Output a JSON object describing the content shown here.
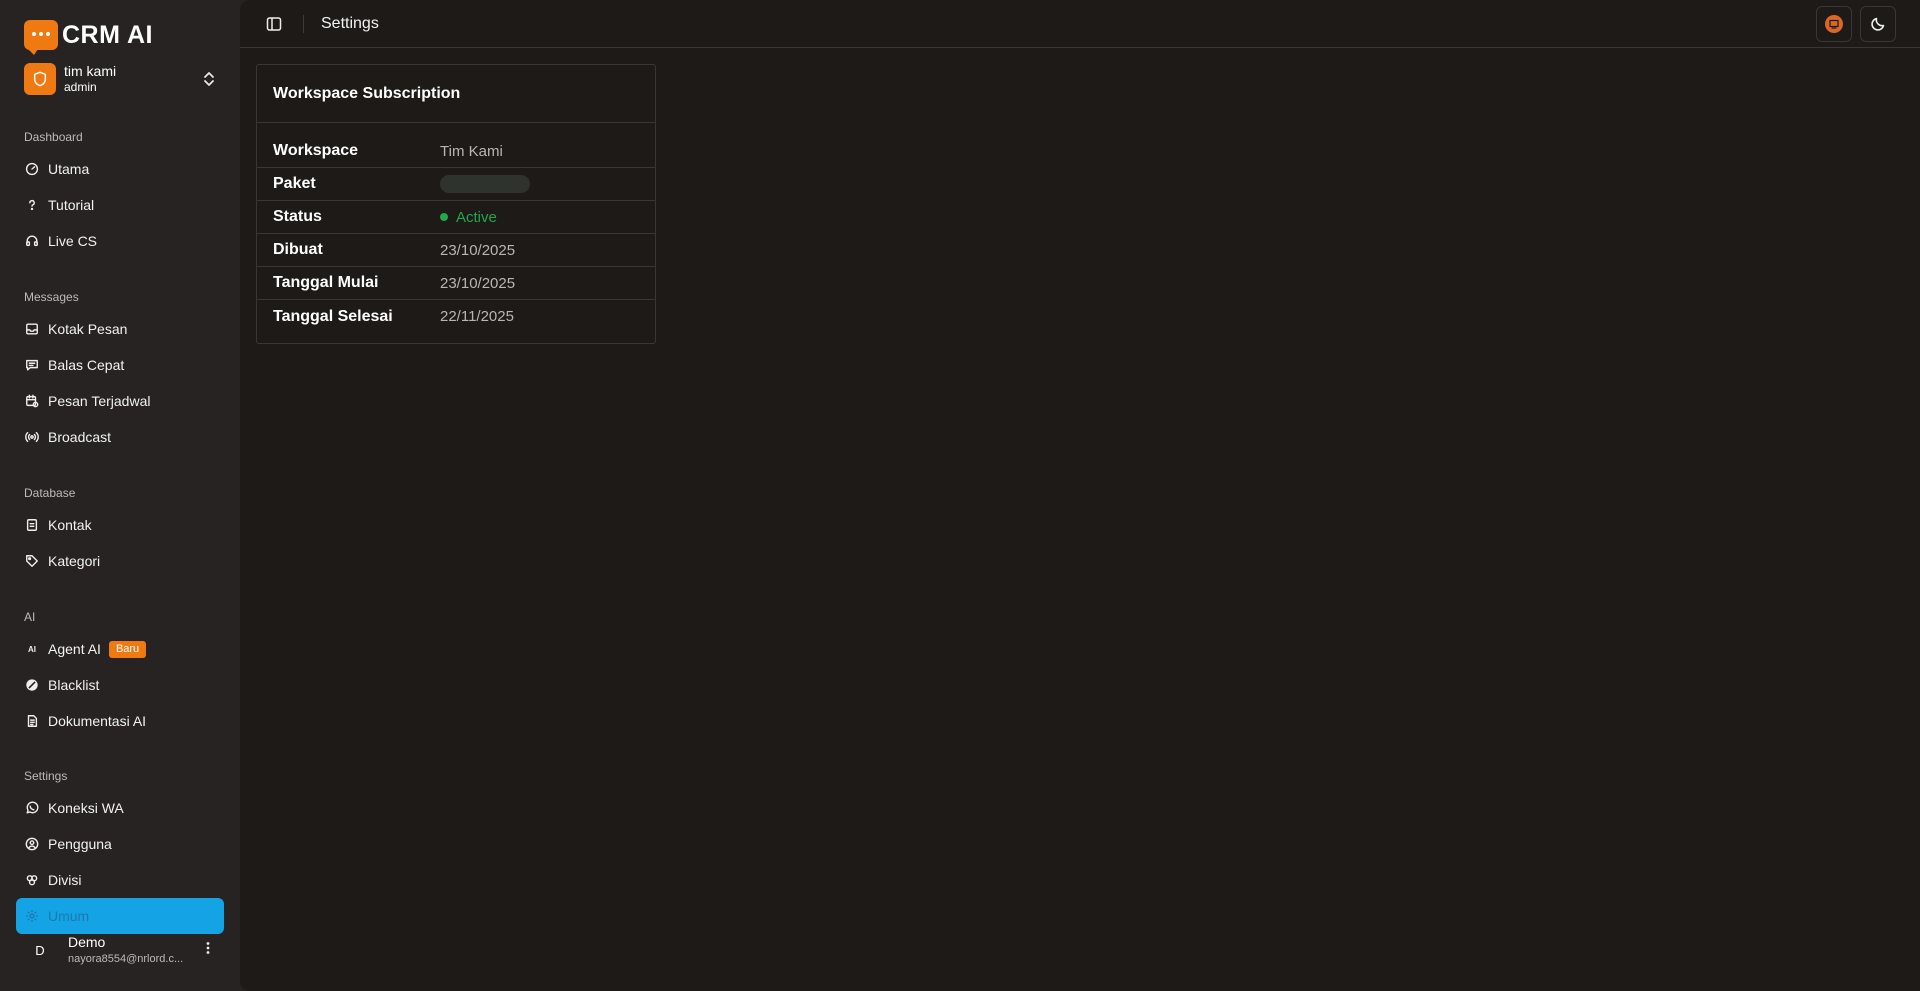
{
  "brand": {
    "name": "CRM AI",
    "color": "#f07a12"
  },
  "workspace": {
    "name": "tim kami",
    "role": "admin"
  },
  "sidebar": {
    "sections": [
      {
        "label": "Dashboard",
        "items": [
          {
            "label": "Utama",
            "icon": "gauge-icon"
          },
          {
            "label": "Tutorial",
            "icon": "question-icon"
          },
          {
            "label": "Live CS",
            "icon": "headset-icon"
          }
        ]
      },
      {
        "label": "Messages",
        "items": [
          {
            "label": "Kotak Pesan",
            "icon": "inbox-icon"
          },
          {
            "label": "Balas Cepat",
            "icon": "quick-reply-icon"
          },
          {
            "label": "Pesan Terjadwal",
            "icon": "calendar-clock-icon"
          },
          {
            "label": "Broadcast",
            "icon": "broadcast-icon"
          }
        ]
      },
      {
        "label": "Database",
        "items": [
          {
            "label": "Kontak",
            "icon": "contact-book-icon"
          },
          {
            "label": "Kategori",
            "icon": "tag-icon"
          }
        ]
      },
      {
        "label": "AI",
        "items": [
          {
            "label": "Agent AI",
            "icon": "ai-icon",
            "badge": "Baru"
          },
          {
            "label": "Blacklist",
            "icon": "ban-icon"
          },
          {
            "label": "Dokumentasi AI",
            "icon": "document-icon"
          }
        ]
      },
      {
        "label": "Settings",
        "items": [
          {
            "label": "Koneksi WA",
            "icon": "whatsapp-icon"
          },
          {
            "label": "Pengguna",
            "icon": "user-circle-icon"
          },
          {
            "label": "Divisi",
            "icon": "group-icon"
          },
          {
            "label": "Umum",
            "icon": "gear-icon",
            "active": true
          }
        ]
      }
    ]
  },
  "user": {
    "initial": "D",
    "name": "Demo",
    "email": "nayora8554@nrlord.c..."
  },
  "header": {
    "title": "Settings"
  },
  "subscription": {
    "title": "Workspace Subscription",
    "rows": [
      {
        "key": "Workspace",
        "value": "Tim Kami"
      },
      {
        "key": "Paket",
        "value": ""
      },
      {
        "key": "Status",
        "value": "Active",
        "status_color": "#22a84a"
      },
      {
        "key": "Dibuat",
        "value": "23/10/2025"
      },
      {
        "key": "Tanggal Mulai",
        "value": "23/10/2025"
      },
      {
        "key": "Tanggal Selesai",
        "value": "22/11/2025"
      }
    ]
  },
  "colors": {
    "active_nav": "#14a4e6",
    "sidebar_bg": "#262322",
    "main_bg": "#1d1a18"
  }
}
